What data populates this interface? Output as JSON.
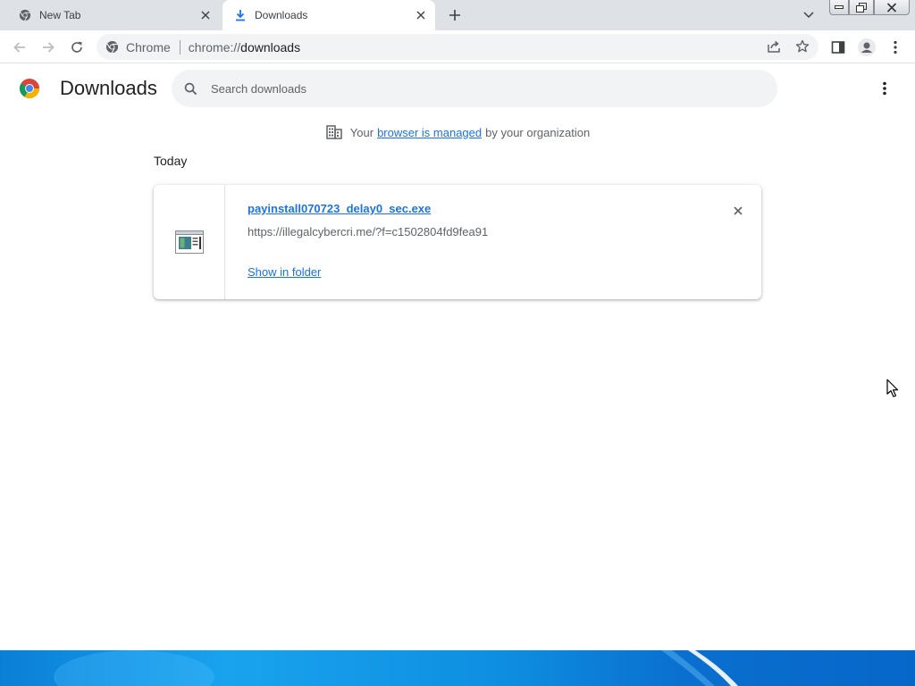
{
  "tabs": [
    {
      "title": "New Tab",
      "icon": "chrome-icon",
      "active": false
    },
    {
      "title": "Downloads",
      "icon": "download-icon",
      "active": true
    }
  ],
  "omnibox": {
    "chip_label": "Chrome",
    "url_scheme": "chrome://",
    "url_host": "downloads"
  },
  "page": {
    "title": "Downloads",
    "search_placeholder": "Search downloads"
  },
  "managed_notice": {
    "prefix": "Your",
    "link": "browser is managed",
    "suffix": "by your organization"
  },
  "date_group": "Today",
  "downloads": [
    {
      "file_name": "payinstall070723_delay0_sec.exe",
      "url": "https://illegalcybercri.me/?f=c1502804fd9fea91",
      "action": "Show in folder"
    }
  ],
  "colors": {
    "link": "#1a73e8",
    "tabstrip": "#dee1e6",
    "omnibox": "#f1f3f4"
  }
}
